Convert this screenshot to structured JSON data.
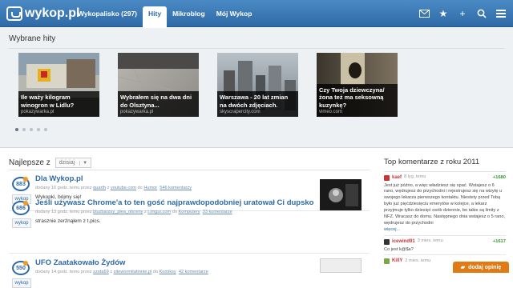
{
  "header": {
    "logo": "wykop.pl",
    "nav": [
      "Wykopalisko (297)",
      "Hity",
      "Mikroblog",
      "Mój Wykop"
    ],
    "icons": [
      "mail-icon",
      "star-icon",
      "plus-icon",
      "search-icon",
      "menu-icon"
    ]
  },
  "hits": {
    "title": "Wybrane hity",
    "items": [
      {
        "caption": "Ile waży kilogram winogron w Lidlu?",
        "source": "pokazywarka.pl"
      },
      {
        "caption": "Wybrałem się na dwa dni do Olsztyna...",
        "source": "pokazywarka.pl"
      },
      {
        "caption": "Warszawa - 20 lat zmian na dwóch zdjęciach.",
        "source": "skyscrapercity.com"
      },
      {
        "caption": "Czy Twoja dziewczyna/ żona też ma seksowną kuzynkę?",
        "source": "vimeo.com"
      }
    ]
  },
  "best": {
    "label": "Najlepsze z",
    "select_value": "dzisiaj"
  },
  "entries": [
    {
      "count": "883",
      "button": "wykop",
      "title": "Dla Wykop.pl",
      "meta_a": "dodany 16 godz. temu przez ",
      "user": "quarth",
      "meta_b": " z ",
      "domain": "youtube.com",
      "meta_c": " do ",
      "category": "Humor",
      "comments": "546 komentarzy",
      "desc": "Wykopki, bójmy się!"
    },
    {
      "count": "686",
      "button": "wykop",
      "title": "Jeśli używasz Chrome'a to ten gość najprawdopodobniej uratował Ci dupsko",
      "meta_a": "dodany 13 godz. temu przez ",
      "user": "bluzbarzuy_plea_obroiny",
      "meta_b": " z ",
      "domain": "t.imgur.com",
      "meta_c": " do ",
      "category": "Komputery",
      "comments": "33 komentarze",
      "desc": "strasznie zerżnąłem z t.pics."
    },
    {
      "count": "550",
      "button": "wykop",
      "title": "UFO Zaatakowało Żydów",
      "meta_a": "dodany 14 godz. temu przez ",
      "user": "szota69",
      "meta_b": " z ",
      "domain": "sitewormitatinnie.pl",
      "meta_c": " do ",
      "category": "Komiksy",
      "comments": "42 komentarze",
      "desc": ""
    }
  ],
  "side": {
    "title": "Top komentarze z roku 2011",
    "comments": [
      {
        "user": "kaef",
        "time": "8 lyg. temu",
        "score": "+1680",
        "body": "Jest już późno, a więc władziesz się spać. Wstajesz o 6 rano, wędrujesz do przychodni i rejestrujesz się na wizytę u swojego lekarza pierwszego kontaktu. Niestety przed Tobą było już pięćdziesięciu emerytów w kolejce, a lekarz przyjmuje tylko dziesięć osób dziennie, bo takie są limity z NFZ. Wracasz do domu. Następnego dnia wstajesz o 5 rano, wędrujesz do przychodni",
        "more": "więcej..."
      },
      {
        "user": "icewind91",
        "time": "3 mies. temu",
        "score": "+1617",
        "body": "Co jest k@$a?",
        "more": ""
      },
      {
        "user": "KillY",
        "time": "2 mies. temu",
        "score": "",
        "body": "",
        "more": ""
      }
    ]
  },
  "feedback": "dodaj opinię",
  "colors": {
    "header": "#2f6aa6",
    "accent": "#f39b1c",
    "feedback": "#e07a15"
  }
}
